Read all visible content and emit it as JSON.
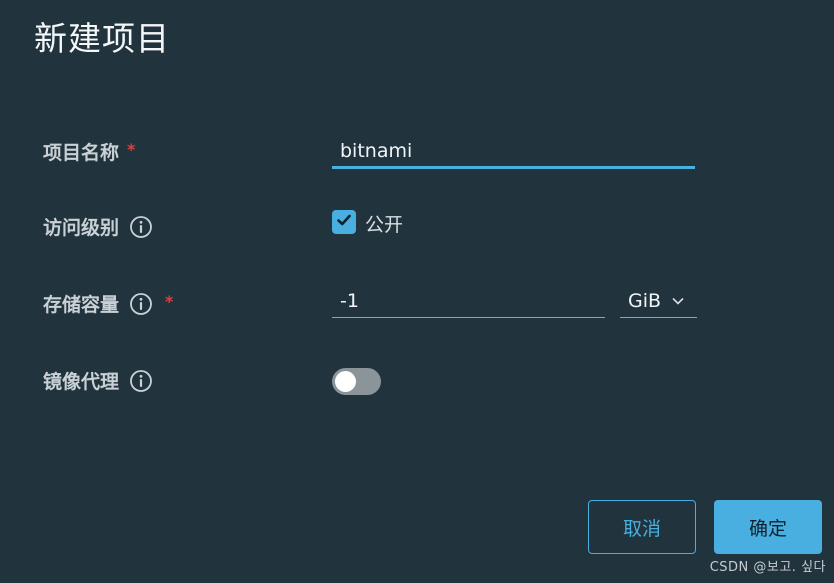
{
  "dialog": {
    "title": "新建项目"
  },
  "fields": {
    "project_name": {
      "label": "项目名称",
      "required_mark": "*",
      "value": "bitnami"
    },
    "access_level": {
      "label": "访问级别",
      "checkbox_label": "公开",
      "checked": true
    },
    "storage_quota": {
      "label": "存储容量",
      "required_mark": "*",
      "value": "-1",
      "unit": "GiB"
    },
    "proxy_cache": {
      "label": "镜像代理",
      "enabled": false
    }
  },
  "icons": {
    "info": "info-icon",
    "check": "checkmark-icon",
    "dropdown": "chevron-down-icon"
  },
  "buttons": {
    "cancel": "取消",
    "confirm": "确定"
  },
  "watermark": "CSDN @보고. 싶다",
  "colors": {
    "background": "#21333d",
    "accent": "#49aee0",
    "required": "#e0403a",
    "toggle_off": "#8a9499"
  }
}
